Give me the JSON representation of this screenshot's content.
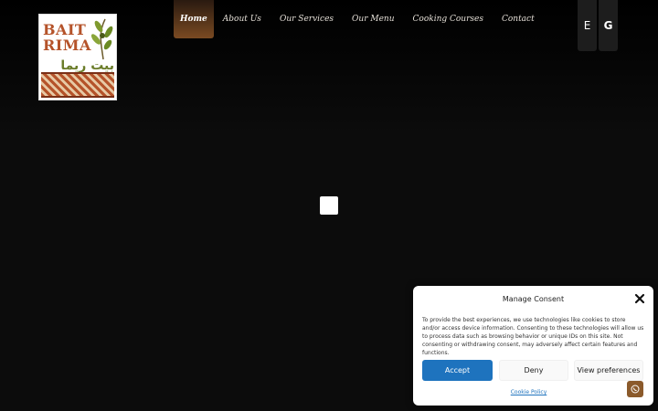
{
  "brand": {
    "name_en": "BAIT RIMA",
    "name_ar": "بيت ريما"
  },
  "nav": {
    "items": [
      {
        "label": "Home",
        "active": true
      },
      {
        "label": "About Us",
        "active": false
      },
      {
        "label": "Our Services",
        "active": false
      },
      {
        "label": "Our Menu",
        "active": false
      },
      {
        "label": "Cooking Courses",
        "active": false
      },
      {
        "label": "Contact",
        "active": false
      }
    ]
  },
  "language_buttons": [
    "E",
    "G"
  ],
  "consent": {
    "title": "Manage Consent",
    "text": "To provide the best experiences, we use technologies like cookies to store and/or access device information. Consenting to these technologies will allow us to process data such as browsing behavior or unique IDs on this site. Not consenting or withdrawing consent, may adversely affect certain features and functions.",
    "accept_label": "Accept",
    "deny_label": "Deny",
    "preferences_label": "View preferences",
    "policy_link": "Cookie Policy"
  },
  "colors": {
    "background": "#0c0c0c",
    "accent_brown": "#8b5a2b",
    "accept_blue": "#1e73be"
  },
  "icons": {
    "close": "close-icon",
    "whatsapp": "whatsapp-icon",
    "loader": "loading-spinner"
  }
}
